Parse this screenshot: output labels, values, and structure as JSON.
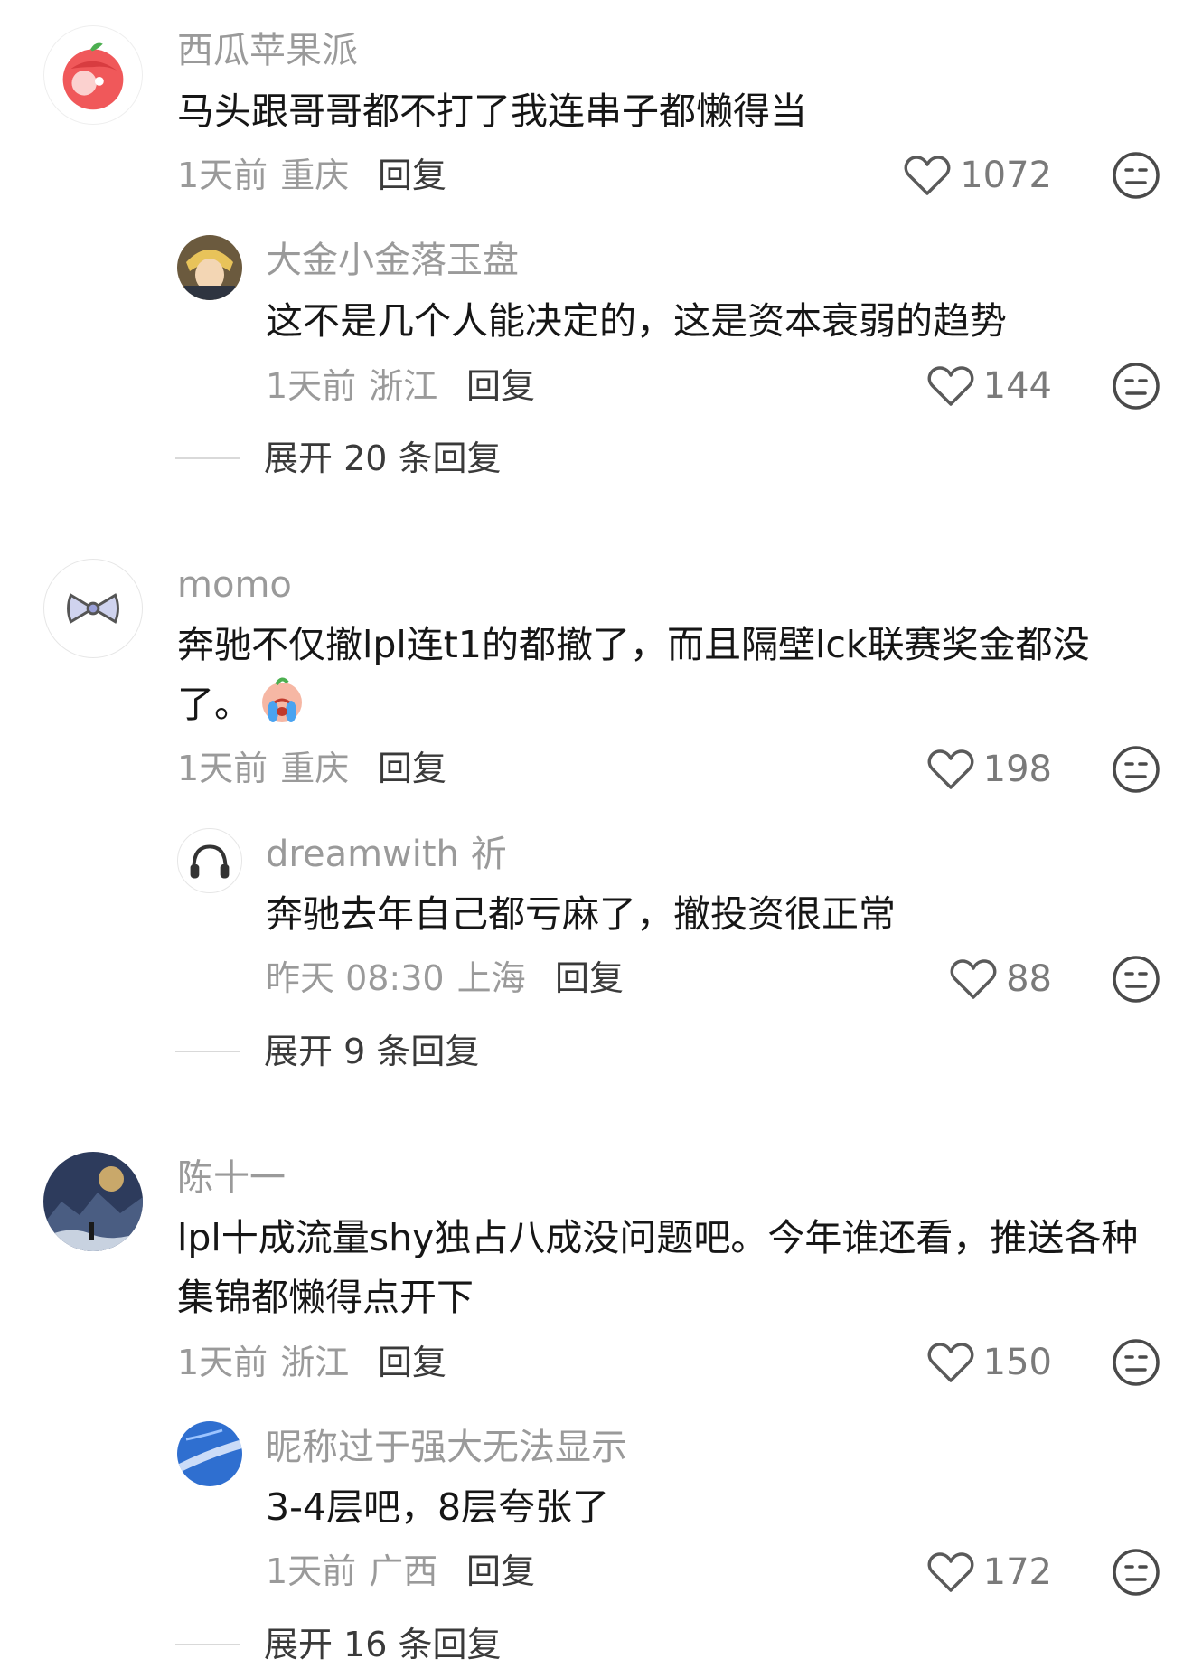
{
  "comments": [
    {
      "username": "西瓜苹果派",
      "text": "马头跟哥哥都不打了我连串子都懒得当",
      "time": "1天前",
      "location": "重庆",
      "reply_label": "回复",
      "likes": "1072",
      "avatar_icon": "red-apple-character-avatar",
      "replies": [
        {
          "username": "大金小金落玉盘",
          "text": "这不是几个人能决定的，这是资本衰弱的趋势",
          "time": "1天前",
          "location": "浙江",
          "reply_label": "回复",
          "likes": "144",
          "avatar_icon": "anime-character-avatar"
        }
      ],
      "expand_label": "展开 20 条回复"
    },
    {
      "username": "momo",
      "text": "奔驰不仅撤lpl连t1的都撤了，而且隔壁lck联赛奖金都没了。",
      "time": "1天前",
      "location": "重庆",
      "reply_label": "回复",
      "likes": "198",
      "avatar_icon": "bow-avatar",
      "emoji_icon": "crying-emoji",
      "replies": [
        {
          "username": "dreamwith 祈",
          "text": "奔驰去年自己都亏麻了，撤投资很正常",
          "time": "昨天 08:30",
          "location": "上海",
          "reply_label": "回复",
          "likes": "88",
          "avatar_icon": "headphones-avatar"
        }
      ],
      "expand_label": "展开 9 条回复"
    },
    {
      "username": "陈十一",
      "text": "lpl十成流量shy独占八成没问题吧。今年谁还看，推送各种集锦都懒得点开下",
      "time": "1天前",
      "location": "浙江",
      "reply_label": "回复",
      "likes": "150",
      "avatar_icon": "fantasy-landscape-avatar",
      "replies": [
        {
          "username": "昵称过于强大无法显示",
          "text": "3-4层吧，8层夸张了",
          "time": "1天前",
          "location": "广西",
          "reply_label": "回复",
          "likes": "172",
          "avatar_icon": "blue-sky-avatar"
        }
      ],
      "expand_label": "展开 16 条回复"
    }
  ],
  "icons": {
    "like": "heart-outline-icon",
    "dislike": "neutral-face-icon"
  },
  "colors": {
    "username": "#9a9a9a",
    "text": "#161616",
    "meta": "#9a9a9a",
    "divider": "#d9d9d9"
  }
}
